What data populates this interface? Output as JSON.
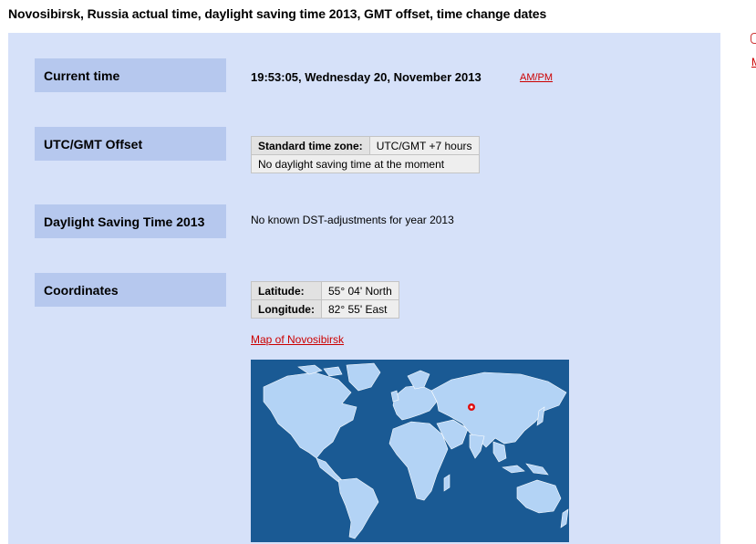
{
  "page": {
    "title": "Novosibirsk, Russia actual time, daylight saving time 2013, GMT offset, time change dates"
  },
  "current_time": {
    "label": "Current time",
    "value": "19:53:05, Wednesday 20, November 2013",
    "ampm_link": "AM/PM"
  },
  "utc_offset": {
    "label": "UTC/GMT Offset",
    "standard_key": "Standard time zone:",
    "standard_value": "UTC/GMT +7 hours",
    "dst_note": "No daylight saving time at the moment"
  },
  "dst": {
    "label": "Daylight Saving Time 2013",
    "note": "No known DST-adjustments for year 2013"
  },
  "coordinates": {
    "label": "Coordinates",
    "latitude_key": "Latitude:",
    "latitude_value": "55° 04' North",
    "longitude_key": "Longitude:",
    "longitude_value": "82° 55' East",
    "map_link": "Map of Novosibirsk"
  },
  "edge": {
    "link_fragment": "M"
  },
  "colors": {
    "panel_bg": "#d6e1f9",
    "label_bg": "#b6c8ee",
    "ocean": "#1a5a94",
    "land": "#b3d3f5",
    "link": "#cc0000",
    "marker": "#e01010"
  },
  "icons": {
    "location_marker": "city-marker-icon"
  }
}
